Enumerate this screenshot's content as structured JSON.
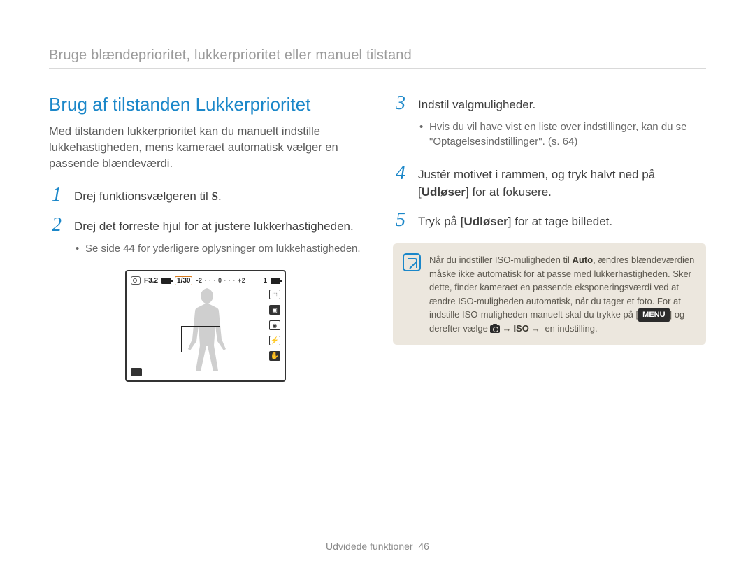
{
  "breadcrumb": "Bruge blændeprioritet, lukkerprioritet eller manuel tilstand",
  "heading": "Brug af tilstanden Lukkerprioritet",
  "intro": "Med tilstanden lukkerprioritet kan du manuelt indstille lukkehastigheden, mens kameraet automatisk vælger en passende blændeværdi.",
  "left": {
    "steps": {
      "s1": {
        "num": "1",
        "pre": "Drej funktionsvælgeren til ",
        "icon": "S",
        "post": "."
      },
      "s2": {
        "num": "2",
        "text": "Drej det forreste hjul for at justere lukkerhastigheden.",
        "bullet": "Se side 44 for yderligere oplysninger om lukkehastigheden."
      }
    }
  },
  "right": {
    "steps": {
      "s3": {
        "num": "3",
        "text": "Indstil valgmuligheder.",
        "bullet": "Hvis du vil have vist en liste over indstillinger, kan du se \"Optagelsesindstillinger\". (s. 64)"
      },
      "s4": {
        "num": "4",
        "pre": "Justér motivet i rammen, og tryk halvt ned på [",
        "bold": "Udløser",
        "post": "] for at fokusere."
      },
      "s5": {
        "num": "5",
        "pre": "Tryk på [",
        "bold": "Udløser",
        "post": "] for at tage billedet."
      }
    }
  },
  "note": {
    "pre": "Når du indstiller ISO-muligheden til ",
    "auto": "Auto",
    "mid": ", ændres blændeværdien måske ikke automatisk for at passe med lukkerhastigheden. Sker dette, finder kameraet en passende eksponeringsværdi ved at ændre ISO-muligheden automatisk, når du tager et foto. For at indstille ISO-muligheden manuelt skal du trykke på [",
    "menu": "MENU",
    "after_menu": "] og derefter vælge ",
    "arrow1": "→",
    "iso": "ISO",
    "arrow2": "→",
    "end": " en indstilling."
  },
  "display": {
    "f_value": "F3.2",
    "shutter": "1/30",
    "ev_scale": "-2 · · · 0 · · · +2",
    "counter": "1"
  },
  "footer": {
    "section": "Udvidede funktioner",
    "page": "46"
  }
}
